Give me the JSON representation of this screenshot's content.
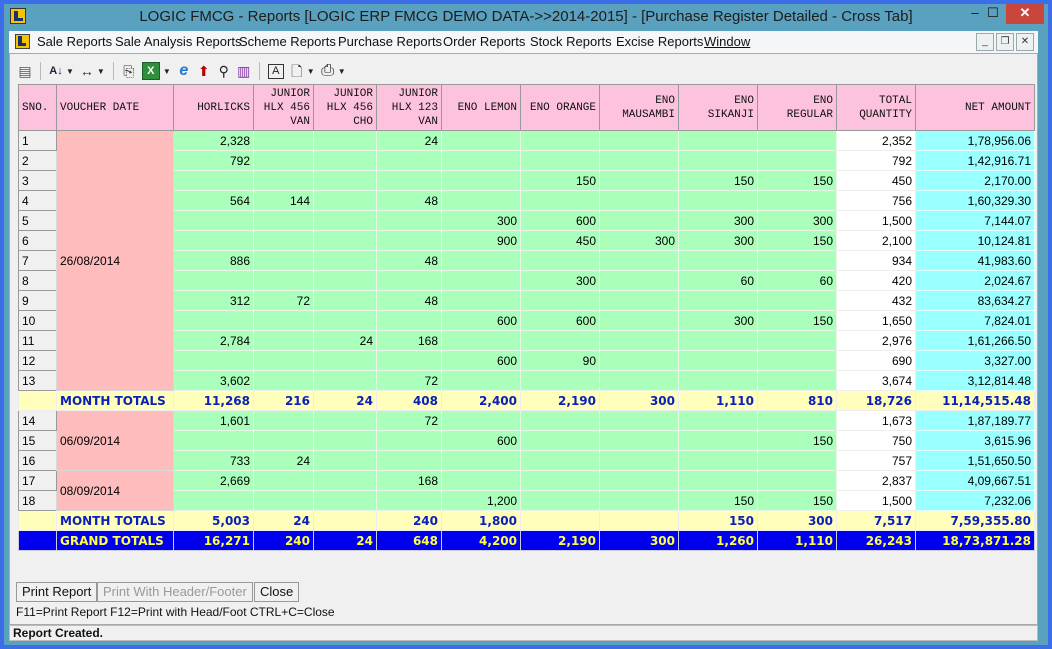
{
  "window": {
    "title": "LOGIC FMCG - Reports  [LOGIC ERP FMCG DEMO DATA->>2014-2015] - [Purchase Register Detailed - Cross Tab]",
    "minimize": "‒",
    "maximize": "☐",
    "close": "✕"
  },
  "menu": {
    "items": [
      "Sale Reports",
      "Sale Analysis Reports",
      "Scheme Reports",
      "Purchase Reports",
      "Order Reports",
      "Stock Reports",
      "Excise Reports",
      "Window"
    ],
    "mdi": {
      "minimize": "_",
      "restore": "❐",
      "close": "✕"
    }
  },
  "toolbar": {
    "icons": [
      {
        "name": "window-icon",
        "glyph": "▤"
      },
      {
        "name": "sort-az-icon",
        "glyph": "A↓"
      },
      {
        "name": "column-width-icon",
        "glyph": "↔"
      },
      {
        "name": "copy-icon",
        "glyph": "⎘"
      },
      {
        "name": "excel-icon",
        "glyph": "X"
      },
      {
        "name": "internet-explorer-icon",
        "glyph": "e"
      },
      {
        "name": "export-up-arrow-icon",
        "glyph": "⬆"
      },
      {
        "name": "find-binoculars-icon",
        "glyph": "⚲"
      },
      {
        "name": "chart-icon",
        "glyph": "▥"
      },
      {
        "name": "font-icon",
        "glyph": "A"
      },
      {
        "name": "print-preview-icon",
        "glyph": "🗋"
      },
      {
        "name": "printer-icon",
        "glyph": "⎙"
      }
    ],
    "dropdown_glyph": "▼"
  },
  "table": {
    "headers": [
      "SNO.",
      "VOUCHER DATE",
      "HORLICKS",
      "JUNIOR HLX 456 VAN",
      "JUNIOR HLX 456 CHO",
      "JUNIOR HLX 123 VAN",
      "ENO LEMON",
      "ENO ORANGE",
      "ENO MAUSAMBI",
      "ENO SIKANJI",
      "ENO REGULAR",
      "TOTAL QUANTITY",
      "NET AMOUNT"
    ],
    "header_lines": [
      [
        "SNO."
      ],
      [
        "VOUCHER DATE"
      ],
      [
        "HORLICKS"
      ],
      [
        "JUNIOR",
        "HLX 456",
        "VAN"
      ],
      [
        "JUNIOR",
        "HLX 456",
        "CHO"
      ],
      [
        "JUNIOR",
        "HLX 123",
        "VAN"
      ],
      [
        "ENO LEMON"
      ],
      [
        "ENO ORANGE"
      ],
      [
        "ENO",
        "MAUSAMBI"
      ],
      [
        "ENO",
        "SIKANJI"
      ],
      [
        "ENO",
        "REGULAR"
      ],
      [
        "TOTAL",
        "QUANTITY"
      ],
      [
        "NET AMOUNT"
      ]
    ],
    "groups": [
      {
        "date": "26/08/2014",
        "rows": [
          {
            "sno": "1",
            "q": [
              "2,328",
              "",
              "",
              "24",
              "",
              "",
              "",
              "",
              ""
            ],
            "total_qty": "2,352",
            "net_amount": "1,78,956.06"
          },
          {
            "sno": "2",
            "q": [
              "792",
              "",
              "",
              "",
              "",
              "",
              "",
              "",
              ""
            ],
            "total_qty": "792",
            "net_amount": "1,42,916.71"
          },
          {
            "sno": "3",
            "q": [
              "",
              "",
              "",
              "",
              "",
              "150",
              "",
              "150",
              "150"
            ],
            "total_qty": "450",
            "net_amount": "2,170.00"
          },
          {
            "sno": "4",
            "q": [
              "564",
              "144",
              "",
              "48",
              "",
              "",
              "",
              "",
              ""
            ],
            "total_qty": "756",
            "net_amount": "1,60,329.30"
          },
          {
            "sno": "5",
            "q": [
              "",
              "",
              "",
              "",
              "300",
              "600",
              "",
              "300",
              "300"
            ],
            "total_qty": "1,500",
            "net_amount": "7,144.07"
          },
          {
            "sno": "6",
            "q": [
              "",
              "",
              "",
              "",
              "900",
              "450",
              "300",
              "300",
              "150"
            ],
            "total_qty": "2,100",
            "net_amount": "10,124.81"
          },
          {
            "sno": "7",
            "q": [
              "886",
              "",
              "",
              "48",
              "",
              "",
              "",
              "",
              ""
            ],
            "total_qty": "934",
            "net_amount": "41,983.60"
          },
          {
            "sno": "8",
            "q": [
              "",
              "",
              "",
              "",
              "",
              "300",
              "",
              "60",
              "60"
            ],
            "total_qty": "420",
            "net_amount": "2,024.67"
          },
          {
            "sno": "9",
            "q": [
              "312",
              "72",
              "",
              "48",
              "",
              "",
              "",
              "",
              ""
            ],
            "total_qty": "432",
            "net_amount": "83,634.27"
          },
          {
            "sno": "10",
            "q": [
              "",
              "",
              "",
              "",
              "600",
              "600",
              "",
              "300",
              "150"
            ],
            "total_qty": "1,650",
            "net_amount": "7,824.01"
          },
          {
            "sno": "11",
            "q": [
              "2,784",
              "",
              "24",
              "168",
              "",
              "",
              "",
              "",
              ""
            ],
            "total_qty": "2,976",
            "net_amount": "1,61,266.50"
          },
          {
            "sno": "12",
            "q": [
              "",
              "",
              "",
              "",
              "600",
              "90",
              "",
              "",
              ""
            ],
            "total_qty": "690",
            "net_amount": "3,327.00"
          },
          {
            "sno": "13",
            "q": [
              "3,602",
              "",
              "",
              "72",
              "",
              "",
              "",
              "",
              ""
            ],
            "total_qty": "3,674",
            "net_amount": "3,12,814.48"
          }
        ]
      },
      {
        "month_total": {
          "label": "MONTH TOTALS",
          "q": [
            "11,268",
            "216",
            "24",
            "408",
            "2,400",
            "2,190",
            "300",
            "1,110",
            "810"
          ],
          "total_qty": "18,726",
          "net_amount": "11,14,515.48"
        }
      },
      {
        "date": "06/09/2014",
        "rows": [
          {
            "sno": "14",
            "q": [
              "1,601",
              "",
              "",
              "72",
              "",
              "",
              "",
              "",
              ""
            ],
            "total_qty": "1,673",
            "net_amount": "1,87,189.77"
          },
          {
            "sno": "15",
            "q": [
              "",
              "",
              "",
              "",
              "600",
              "",
              "",
              "",
              "150"
            ],
            "total_qty": "750",
            "net_amount": "3,615.96"
          },
          {
            "sno": "16",
            "q": [
              "733",
              "24",
              "",
              "",
              "",
              "",
              "",
              "",
              ""
            ],
            "total_qty": "757",
            "net_amount": "1,51,650.50"
          }
        ]
      },
      {
        "date": "08/09/2014",
        "rows": [
          {
            "sno": "17",
            "q": [
              "2,669",
              "",
              "",
              "168",
              "",
              "",
              "",
              "",
              ""
            ],
            "total_qty": "2,837",
            "net_amount": "4,09,667.51"
          },
          {
            "sno": "18",
            "q": [
              "",
              "",
              "",
              "",
              "1,200",
              "",
              "",
              "150",
              "150"
            ],
            "total_qty": "1,500",
            "net_amount": "7,232.06"
          }
        ]
      },
      {
        "month_total": {
          "label": "MONTH TOTALS",
          "q": [
            "5,003",
            "24",
            "",
            "240",
            "1,800",
            "",
            "",
            "150",
            "300"
          ],
          "total_qty": "7,517",
          "net_amount": "7,59,355.80"
        }
      }
    ],
    "grand_total": {
      "label": "GRAND TOTALS",
      "q": [
        "16,271",
        "240",
        "24",
        "648",
        "4,200",
        "2,190",
        "300",
        "1,260",
        "1,110"
      ],
      "total_qty": "26,243",
      "net_amount": "18,73,871.28"
    }
  },
  "buttons": {
    "print_report": "Print Report",
    "print_header_footer": "Print With Header/Footer",
    "close": "Close"
  },
  "shortcuts": "F11=Print Report  F12=Print with Head/Foot  CTRL+C=Close",
  "status": "Report Created.",
  "colors": {
    "header_bg": "#fdc2de",
    "date_bg": "#ffbcbc",
    "qty_bg": "#aaffbb",
    "net_amount_bg": "#99ffff",
    "month_total_bg": "#ffffbb",
    "month_total_text": "#0b20b8",
    "grand_total_bg": "#0000ee",
    "grand_total_text": "#ffff44"
  }
}
